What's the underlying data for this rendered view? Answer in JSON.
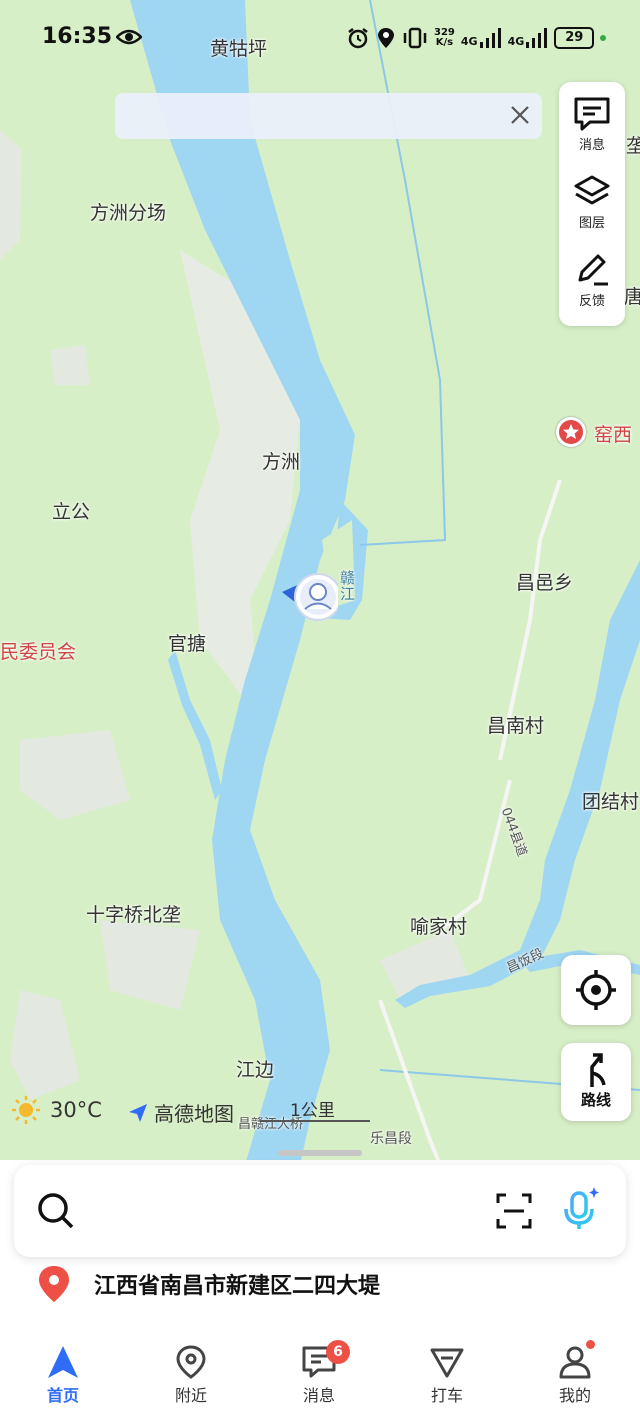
{
  "status_bar": {
    "time": "16:35",
    "net_speed": "329",
    "net_unit": "K/s",
    "sig1": "4G",
    "sig2": "4G",
    "battery": "29"
  },
  "map": {
    "labels": {
      "huangguping": "黄牯坪",
      "fangzhou_fenchang": "方洲分场",
      "fangzhou": "方洲",
      "ligong": "立公",
      "guantang": "官搪",
      "weiyuanhui": "民委员会",
      "changyixiang": "昌邑乡",
      "changnancun": "昌南村",
      "tuanjiecun": "团结村",
      "yujiacun": "喻家村",
      "shizi": "十字桥北垄",
      "jiangbian": "江边",
      "gan_river": "赣江",
      "road_044": "044县道",
      "changfan": "昌饭段",
      "lechang": "乐昌段",
      "bridge": "昌赣江大桥",
      "edge_top": "垄",
      "edge_mid": "唐",
      "yaoxi": "窑西"
    },
    "weather": "30°C",
    "brand": "高德地图",
    "scale": "1公里"
  },
  "tools": {
    "message": "消息",
    "layers": "图层",
    "feedback": "反馈"
  },
  "route_label": "路线",
  "search": {
    "placeholder": ""
  },
  "address": "江西省南昌市新建区二四大堤",
  "nav": {
    "home": "首页",
    "nearby": "附近",
    "messages": "消息",
    "messages_badge": "6",
    "taxi": "打车",
    "mine": "我的"
  },
  "colors": {
    "water": "#9fd6f2",
    "land": "#d7efc7",
    "accent": "#2f6df6",
    "poi_red": "#e24a4a"
  }
}
